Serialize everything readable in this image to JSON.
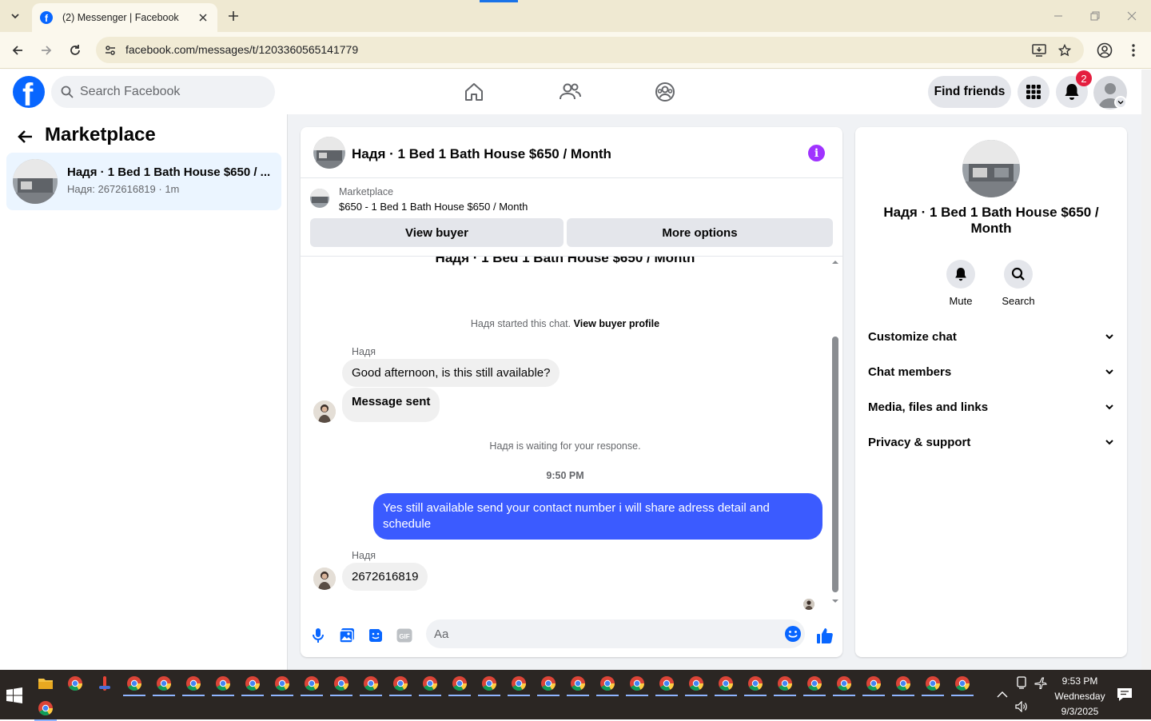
{
  "browser": {
    "tab_title": "(2) Messenger | Facebook",
    "url": "facebook.com/messages/t/1203360565141779"
  },
  "fb_header": {
    "logo": "f",
    "search_placeholder": "Search Facebook",
    "find_friends_label": "Find friends",
    "notification_count": "2"
  },
  "left_pane": {
    "title": "Marketplace",
    "conversation": {
      "name": "Надя · 1 Bed 1 Bath House $650 / ...",
      "subtitle": "Надя: 2672616819 · 1m"
    }
  },
  "chat": {
    "header_title": "Надя · 1 Bed 1 Bath House $650 / Month",
    "info_icon_glyph": "i",
    "marketplace_label": "Marketplace",
    "listing_line": "$650 - 1 Bed 1 Bath House $650 / Month",
    "view_buyer_label": "View buyer",
    "more_options_label": "More options",
    "thread_title": "Надя · 1 Bed 1 Bath House $650 / Month",
    "started_text": "Надя started this chat.",
    "view_buyer_profile_label": "View buyer profile",
    "sender_name": "Надя",
    "messages": [
      {
        "text": "Good afternoon, is this still available?"
      },
      {
        "text": "Message sent"
      }
    ],
    "waiting_text": "Надя is waiting for your response.",
    "timestamp": "9:50 PM",
    "outgoing_message": "Yes still available send your contact number i will share adress detail and schedule",
    "last_message": "2672616819",
    "composer_placeholder": "Aa"
  },
  "right_pane": {
    "name": "Надя · 1 Bed 1 Bath House $650 / Month",
    "mute_label": "Mute",
    "search_label": "Search",
    "sections": [
      {
        "label": "Customize chat"
      },
      {
        "label": "Chat members"
      },
      {
        "label": "Media, files and links"
      },
      {
        "label": "Privacy & support"
      }
    ]
  },
  "taskbar": {
    "time": "9:53 PM",
    "day": "Wednesday",
    "date": "9/3/2025"
  },
  "colors": {
    "facebook_blue": "#0866ff",
    "outgoing_bubble": "#3b5bff",
    "info_purple": "#a033ff",
    "badge_red": "#e41e3f",
    "selected_conversation": "#ebf5ff"
  }
}
